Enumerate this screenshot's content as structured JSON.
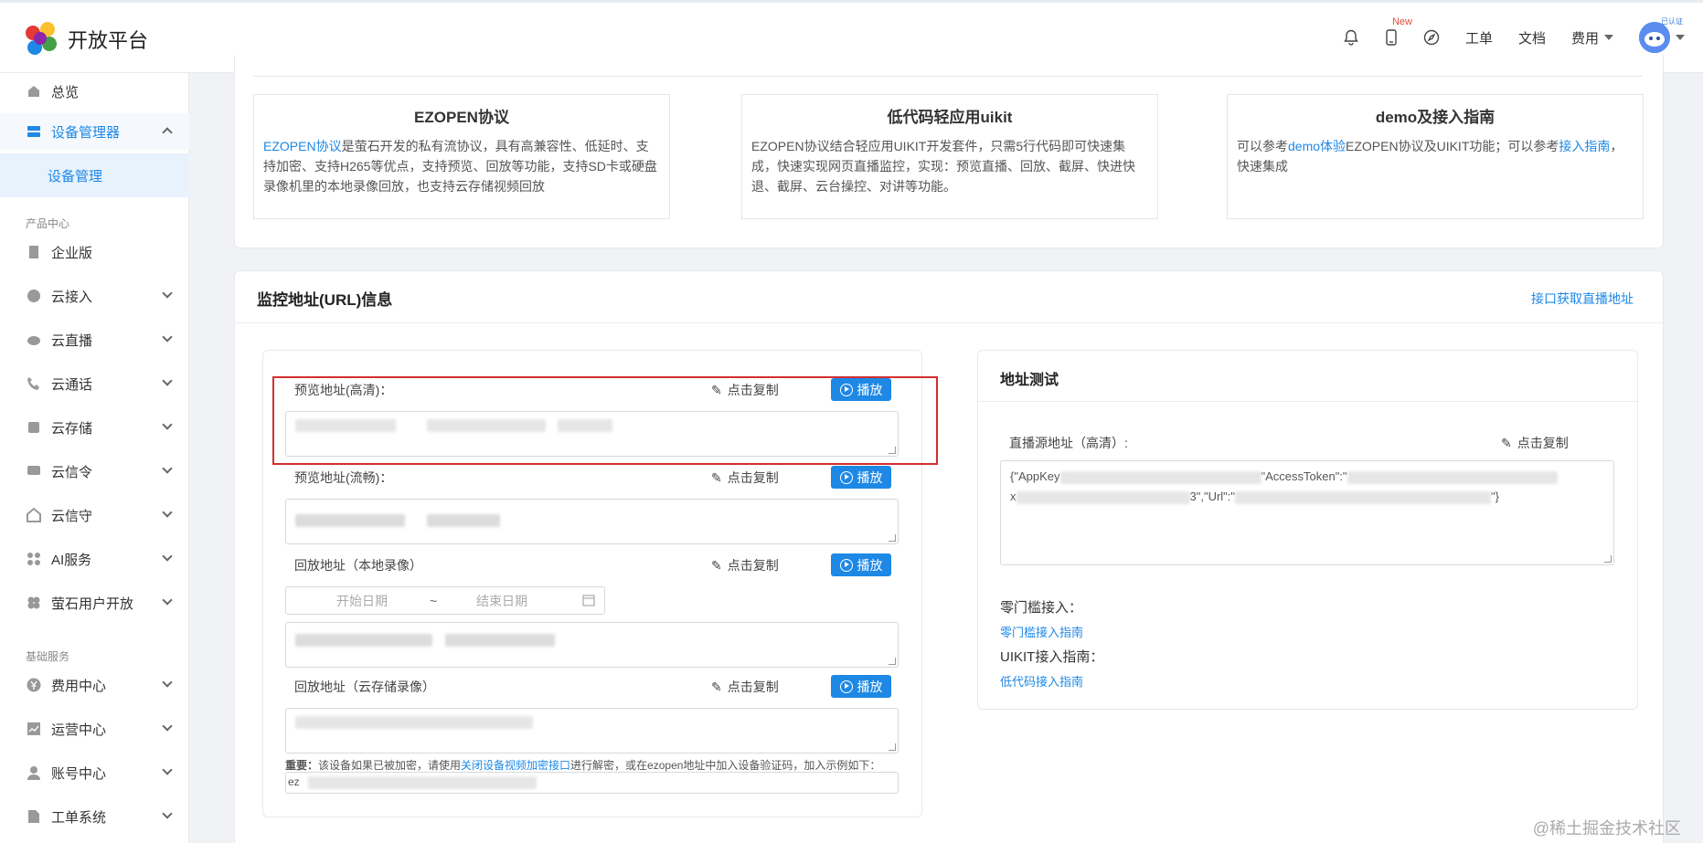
{
  "header": {
    "app_title": "开放平台",
    "new_badge": "New",
    "links": [
      "工单",
      "文档"
    ],
    "fee_dropdown": "费用",
    "avatar_tag": "已认证",
    "icons": [
      "bell-icon",
      "mobile-icon",
      "compass-icon"
    ]
  },
  "sidebar": {
    "overview": "总览",
    "device_manager": "设备管理器",
    "device_manage": "设备管理",
    "group_product": "产品中心",
    "enterprise": "企业版",
    "cloud_access": "云接入",
    "cloud_live": "云直播",
    "cloud_call": "云通话",
    "cloud_storage": "云存储",
    "cloud_signal": "云信令",
    "cloud_guard": "云信守",
    "ai_service": "AI服务",
    "ys_user_open": "萤石用户开放",
    "group_base": "基础服务",
    "fee_center": "费用中心",
    "ops_center": "运营中心",
    "account_center": "账号中心",
    "ticket_system": "工单系统"
  },
  "info_cards": [
    {
      "title": "EZOPEN协议",
      "link": "EZOPEN协议",
      "body": "是萤石开发的私有流协议，具有高兼容性、低延时、支持加密、支持H265等优点，支持预览、回放等功能，支持SD卡或硬盘录像机里的本地录像回放，也支持云存储视频回放"
    },
    {
      "title": "低代码轻应用uikit",
      "body": "EZOPEN协议结合轻应用UIKIT开发套件，只需5行代码即可快速集成，快速实现网页直播监控，实现：预览直播、回放、截屏、快进快退、截屏、云台操控、对讲等功能。"
    },
    {
      "title": "demo及接入指南",
      "pre": "可以参考",
      "link1": "demo体验",
      "mid": "EZOPEN协议及UIKIT功能；可以参考",
      "link2": "接入指南",
      "post": "，快速集成"
    }
  ],
  "url_section": {
    "title": "监控地址(URL)信息",
    "api_link": "接口获取直播地址",
    "copy_label": "点击复制",
    "play_label": "播放",
    "fields": [
      {
        "label": "预览地址(高清)：",
        "value": "ezopen://open.ys7.com/.../1.hd.live"
      },
      {
        "label": "预览地址(流畅)：",
        "value": ""
      },
      {
        "label": "回放地址（本地录像）",
        "value": ""
      },
      {
        "label": "回放地址（云存储录像）",
        "value": "ezopen://open.ys7.com/.../1.cloud.rec"
      }
    ],
    "date_start": "开始日期",
    "date_sep": "~",
    "date_end": "结束日期",
    "notice_bold": "重要：",
    "notice_pre": "该设备如果已被加密，请使用",
    "notice_link": "关闭设备视频加密接口",
    "notice_post": "进行解密，或在ezopen地址中加入设备验证码，加入示例如下：",
    "example_prefix": "ez"
  },
  "test_section": {
    "title": "地址测试",
    "source_label": "直播源地址（高清）:",
    "copy_label": "点击复制",
    "source_line1_a": "{\"AppKey",
    "source_line1_b": "\"AccessToken\":\"",
    "source_line2_a": "x",
    "source_line2_b": "3\",\"Url\":\"",
    "source_line2_c": "\"}",
    "zero_label": "零门槛接入：",
    "zero_link": "零门槛接入指南",
    "uikit_label": "UIKIT接入指南：",
    "uikit_link": "低代码接入指南"
  },
  "watermark": "@稀土掘金技术社区",
  "colors": {
    "accent": "#1e88e5",
    "highlight_frame": "#d32f2f"
  }
}
